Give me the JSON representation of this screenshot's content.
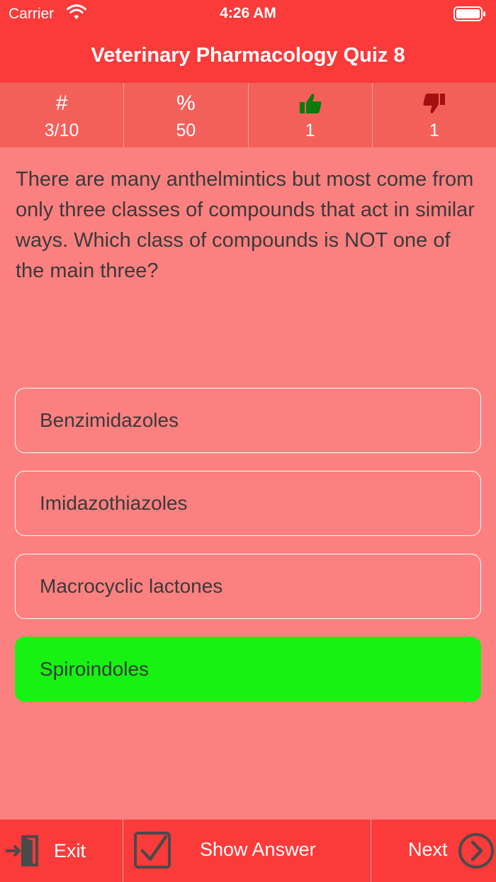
{
  "status_bar": {
    "carrier": "Carrier",
    "time": "4:26 AM"
  },
  "header": {
    "title": "Veterinary Pharmacology Quiz 8"
  },
  "stats": {
    "question_symbol": "#",
    "question_value": "3/10",
    "percent_symbol": "%",
    "percent_value": "50",
    "correct_value": "1",
    "wrong_value": "1"
  },
  "question": {
    "text": "There are many anthelmintics but most come from only three classes of compounds that act in similar ways. Which class of compounds is NOT one of the main three?"
  },
  "answers": [
    {
      "label": "Benzimidazoles",
      "state": "default"
    },
    {
      "label": "Imidazothiazoles",
      "state": "default"
    },
    {
      "label": "Macrocyclic lactones",
      "state": "default"
    },
    {
      "label": "Spiroindoles",
      "state": "correct"
    }
  ],
  "toolbar": {
    "exit_label": "Exit",
    "show_answer_label": "Show Answer",
    "next_label": "Next"
  },
  "colors": {
    "accent_red": "#fb3a3a",
    "background": "#fd8080",
    "stats_bg": "#f3605a",
    "correct_green": "#17f213",
    "thumb_up": "#0c7a0c",
    "thumb_down": "#a31010"
  },
  "icons": {
    "exit": "exit-door-icon",
    "show_answer": "checkbox-icon",
    "next": "chevron-circle-right-icon",
    "correct": "thumbs-up-icon",
    "wrong": "thumbs-down-icon"
  }
}
